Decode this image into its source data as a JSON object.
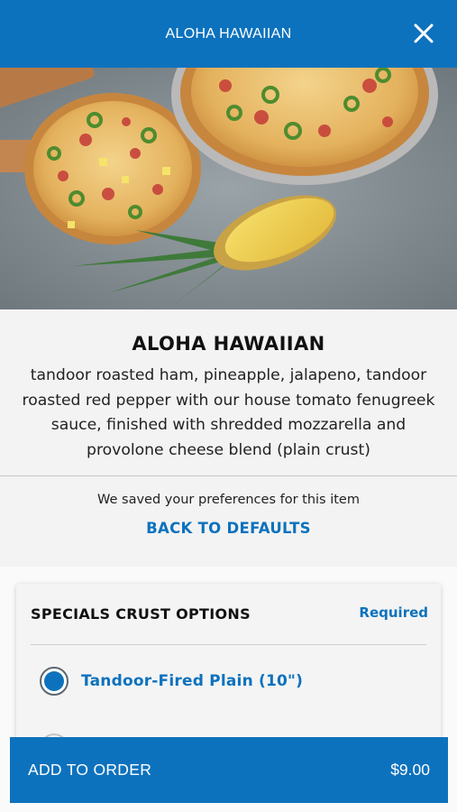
{
  "header": {
    "title": "ALOHA HAWAIIAN",
    "close_icon": "close-icon"
  },
  "hero": {
    "icon": "pizza-photo"
  },
  "product": {
    "title": "ALOHA HAWAIIAN",
    "description": "tandoor roasted ham, pineapple, jalapeno, tandoor roasted red pepper with our house tomato fenugreek sauce, finished with shredded mozzarella and provolone cheese blend (plain crust)"
  },
  "preferences": {
    "notice": "We saved your preferences for this item",
    "reset_label": "BACK TO DEFAULTS"
  },
  "options": {
    "title": "SPECIALS CRUST OPTIONS",
    "required_label": "Required",
    "items": [
      {
        "label": "Tandoor-Fired Plain (10\")",
        "selected": true
      }
    ]
  },
  "order": {
    "label": "ADD TO ORDER",
    "price": "$9.00"
  },
  "colors": {
    "brand_blue": "#0d72bd",
    "background": "#f3f3f3"
  }
}
